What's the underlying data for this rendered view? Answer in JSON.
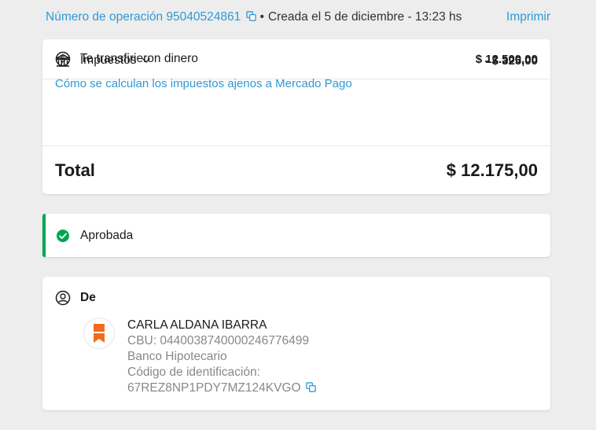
{
  "header": {
    "operation_label": "Número de operación 95040524861",
    "separator": "•",
    "created": "Creada el 5 de diciembre - 13:23 hs",
    "print_label": "Imprimir"
  },
  "summary": {
    "transfer_label": "Te transfirieron dinero",
    "transfer_amount": "$ 12.500,00",
    "taxes_label": "Impuestos",
    "taxes_amount": "- $ 325,00",
    "taxes_link": "Cómo se calculan los impuestos ajenos a Mercado Pago",
    "total_label": "Total",
    "total_amount": "$ 12.175,00"
  },
  "status": {
    "label": "Aprobada",
    "color": "#00a650"
  },
  "from": {
    "title": "De",
    "name": "CARLA ALDANA IBARRA",
    "cbu": "CBU: 0440038740000246776499",
    "bank": "Banco Hipotecario",
    "id_label": "Código de identificación:",
    "id_value": "67REZ8NP1PDY7MZ124KVGO"
  },
  "colors": {
    "link": "#2d9ad6",
    "success": "#00a650",
    "bank_brand": "#f26b1d"
  },
  "icons": [
    "copy-icon",
    "dollar-circle-icon",
    "bank-icon",
    "chevron-down-icon",
    "check-circle-icon",
    "user-circle-icon",
    "bank-logo-icon"
  ]
}
